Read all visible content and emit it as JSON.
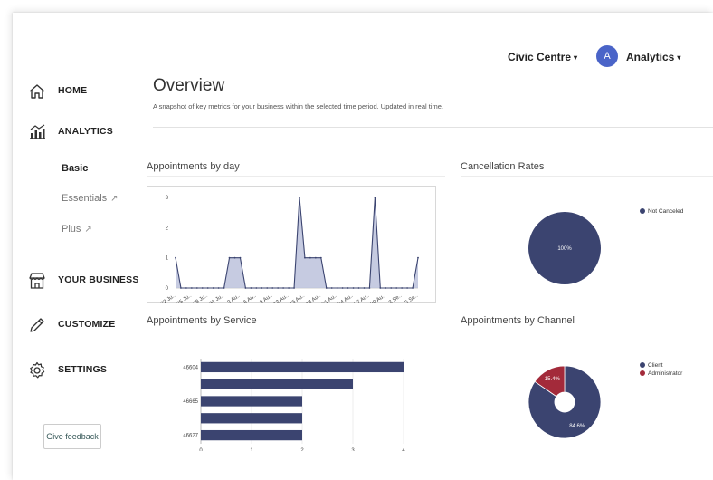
{
  "header": {
    "org_name": "Civic Centre",
    "avatar_initial": "A",
    "account_label": "Analytics",
    "caret": "▾"
  },
  "sidebar": {
    "items": [
      {
        "label": "HOME",
        "icon": "home-icon"
      },
      {
        "label": "ANALYTICS",
        "icon": "analytics-icon"
      },
      {
        "label": "YOUR BUSINESS",
        "icon": "store-icon"
      },
      {
        "label": "CUSTOMIZE",
        "icon": "pencil-icon"
      },
      {
        "label": "SETTINGS",
        "icon": "gear-icon"
      }
    ],
    "sub_items": [
      {
        "label": "Basic",
        "active": true
      },
      {
        "label": "Essentials",
        "external": true
      },
      {
        "label": "Plus",
        "external": true
      }
    ],
    "external_icon": "↗",
    "feedback_label": "Give feedback"
  },
  "main": {
    "title": "Overview",
    "subtitle": "A snapshot of key metrics for your business within the selected time period. Updated in real time.",
    "sections": {
      "by_day": "Appointments by day",
      "cancellation": "Cancellation Rates",
      "by_service": "Appointments by Service",
      "by_channel": "Appointments by Channel"
    }
  },
  "colors": {
    "navy": "#3b4470",
    "area_fill": "#bcc2dc",
    "red": "#a32a3a",
    "accent": "#4a64c8"
  },
  "chart_data": [
    {
      "type": "area",
      "title": "Appointments by day",
      "ylim": [
        0,
        3
      ],
      "yticks": [
        0,
        1,
        2,
        3
      ],
      "x": [
        "22 Jul",
        "23 Jul",
        "24 Jul",
        "25 Jul",
        "26 Jul",
        "27 Jul",
        "28 Jul",
        "29 Jul",
        "30 Jul",
        "31 Jul",
        "1 Aug",
        "2 Aug",
        "3 Aug",
        "4 Aug",
        "5 Aug",
        "6 Aug",
        "7 Aug",
        "8 Aug",
        "9 Aug",
        "10 Aug",
        "11 Aug",
        "12 Aug",
        "13 Aug",
        "14 Aug",
        "15 Aug",
        "16 Aug",
        "17 Aug",
        "18 Aug",
        "19 Aug",
        "20 Aug",
        "21 Aug",
        "22 Aug",
        "23 Aug",
        "24 Aug",
        "25 Aug",
        "26 Aug",
        "27 Aug",
        "28 Aug",
        "29 Aug",
        "30 Aug",
        "31 Aug",
        "1 Sep",
        "2 Sep",
        "3 Sep",
        "4 Sep",
        "5 Sep"
      ],
      "x_tick_labels": [
        "22 Ju..",
        "25 Ju..",
        "28 Ju..",
        "31 Ju..",
        "3 Au..",
        "6 Au..",
        "9 Au..",
        "12 Au..",
        "15 Au..",
        "18 Au..",
        "21 Au..",
        "24 Au..",
        "27 Au..",
        "30 Au..",
        "2 Se..",
        "5 Se.."
      ],
      "values": [
        1,
        0,
        0,
        0,
        0,
        0,
        0,
        0,
        0,
        0,
        1,
        1,
        1,
        0,
        0,
        0,
        0,
        0,
        0,
        0,
        0,
        0,
        0,
        3,
        1,
        1,
        1,
        1,
        0,
        0,
        0,
        0,
        0,
        0,
        0,
        0,
        0,
        3,
        0,
        0,
        0,
        0,
        0,
        0,
        0,
        1
      ],
      "grid": false
    },
    {
      "type": "pie",
      "title": "Cancellation Rates",
      "slices": [
        {
          "label": "Not Canceled",
          "value": 100
        }
      ],
      "slice_labels": [
        "100%"
      ],
      "legend": "top-right"
    },
    {
      "type": "bar",
      "orientation": "horizontal",
      "title": "Appointments by Service",
      "categories": [
        "46604",
        "",
        "46665",
        "",
        "46627"
      ],
      "values": [
        4,
        3,
        2,
        2,
        2
      ],
      "xlim": [
        0,
        4
      ],
      "xticks": [
        0,
        1,
        2,
        3,
        4
      ],
      "grid": true
    },
    {
      "type": "pie",
      "title": "Appointments by Channel",
      "donut": true,
      "slices": [
        {
          "label": "Client",
          "value": 84.6
        },
        {
          "label": "Administrator",
          "value": 15.4
        }
      ],
      "slice_labels": [
        "84.6%",
        "15.4%"
      ],
      "legend": "top-right"
    }
  ]
}
